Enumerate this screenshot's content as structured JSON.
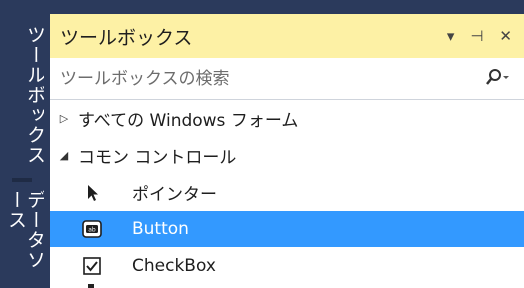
{
  "dock": {
    "toolbox_tab": "ツールボックス",
    "datasource_tab": "データソース"
  },
  "panel": {
    "title": "ツールボックス",
    "title_buttons": {
      "dropdown": "▾",
      "pin": "⊣",
      "close": "✕"
    }
  },
  "search": {
    "placeholder": "ツールボックスの検索"
  },
  "tree": {
    "categories": [
      {
        "label": "すべての Windows フォーム",
        "expanded": false
      },
      {
        "label": "コモン コントロール",
        "expanded": true
      }
    ],
    "items": [
      {
        "label": "ポインター",
        "icon": "pointer-arrow-icon"
      },
      {
        "label": "Button",
        "icon": "button-control-icon",
        "selected": true
      },
      {
        "label": "CheckBox",
        "icon": "checkbox-icon"
      }
    ]
  },
  "colors": {
    "dock_bg": "#2b3a5c",
    "title_bg": "#fdf1a5",
    "selection": "#3399ff"
  }
}
